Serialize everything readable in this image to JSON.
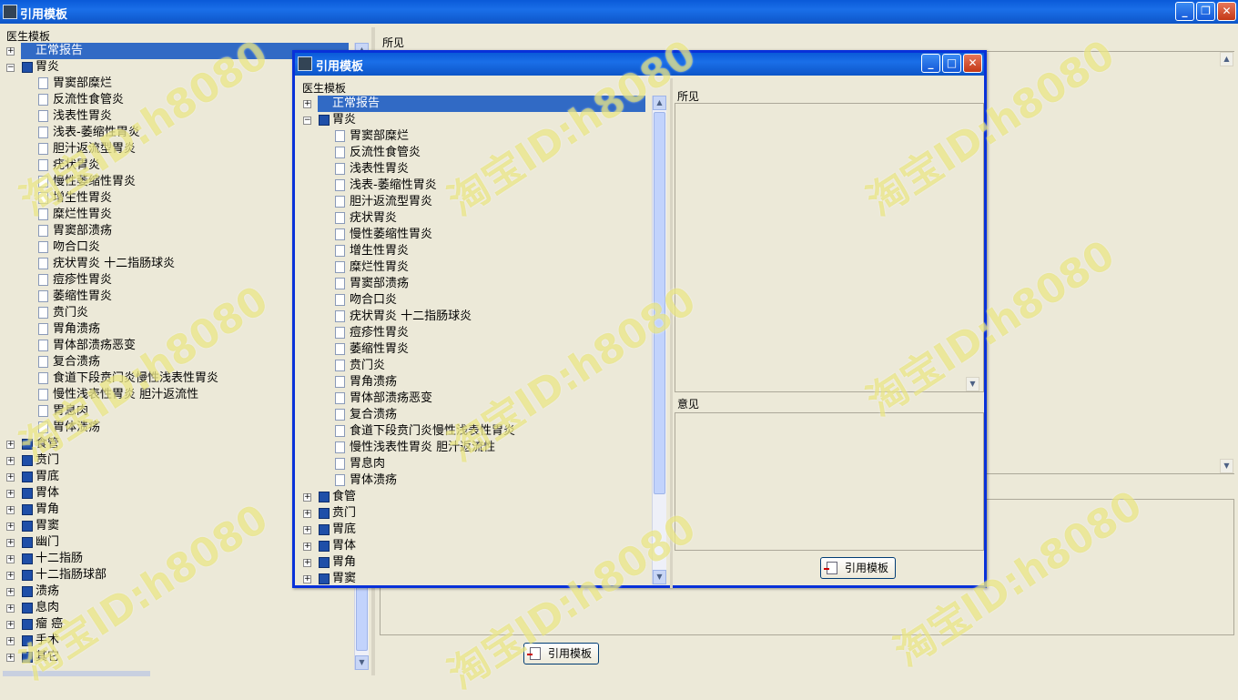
{
  "main": {
    "title": "引用模板",
    "controls": {
      "minimize": "_",
      "restore": "❐",
      "close": "✕"
    },
    "left_label": "医生模板",
    "findings_label": "所见",
    "cite_button": "引用模板",
    "tree": [
      {
        "label": "正常报告",
        "kind": "folder",
        "selected": true,
        "expander": "+"
      },
      {
        "label": "胃炎",
        "kind": "folder",
        "expander": "−"
      },
      {
        "label": "胃窦部糜烂",
        "kind": "doc"
      },
      {
        "label": "反流性食管炎",
        "kind": "doc"
      },
      {
        "label": "浅表性胃炎",
        "kind": "doc"
      },
      {
        "label": "浅表-萎缩性胃炎",
        "kind": "doc"
      },
      {
        "label": "胆汁返流型胃炎",
        "kind": "doc"
      },
      {
        "label": "疣状胃炎",
        "kind": "doc"
      },
      {
        "label": "慢性萎缩性胃炎",
        "kind": "doc"
      },
      {
        "label": "增生性胃炎",
        "kind": "doc"
      },
      {
        "label": "糜烂性胃炎",
        "kind": "doc"
      },
      {
        "label": "胃窦部溃疡",
        "kind": "doc"
      },
      {
        "label": "吻合口炎",
        "kind": "doc"
      },
      {
        "label": "疣状胃炎 十二指肠球炎",
        "kind": "doc"
      },
      {
        "label": "痘疹性胃炎",
        "kind": "doc"
      },
      {
        "label": "萎缩性胃炎",
        "kind": "doc"
      },
      {
        "label": "贲门炎",
        "kind": "doc"
      },
      {
        "label": "胃角溃疡",
        "kind": "doc"
      },
      {
        "label": "胃体部溃疡恶变",
        "kind": "doc"
      },
      {
        "label": "复合溃疡",
        "kind": "doc"
      },
      {
        "label": "食道下段贲门炎慢性浅表性胃炎",
        "kind": "doc"
      },
      {
        "label": "慢性浅表性胃炎 胆汁返流性",
        "kind": "doc"
      },
      {
        "label": "胃息肉",
        "kind": "doc"
      },
      {
        "label": "胃体溃疡",
        "kind": "doc"
      },
      {
        "label": "食管",
        "kind": "folder",
        "expander": "+"
      },
      {
        "label": "贲门",
        "kind": "folder",
        "expander": "+"
      },
      {
        "label": "胃底",
        "kind": "folder",
        "expander": "+"
      },
      {
        "label": "胃体",
        "kind": "folder",
        "expander": "+"
      },
      {
        "label": "胃角",
        "kind": "folder",
        "expander": "+"
      },
      {
        "label": "胃窦",
        "kind": "folder",
        "expander": "+"
      },
      {
        "label": "幽门",
        "kind": "folder",
        "expander": "+"
      },
      {
        "label": "十二指肠",
        "kind": "folder",
        "expander": "+"
      },
      {
        "label": "十二指肠球部",
        "kind": "folder",
        "expander": "+"
      },
      {
        "label": "溃疡",
        "kind": "folder",
        "expander": "+"
      },
      {
        "label": "息肉",
        "kind": "folder",
        "expander": "+"
      },
      {
        "label": "瘤 癌",
        "kind": "folder",
        "expander": "+"
      },
      {
        "label": "手术",
        "kind": "folder",
        "expander": "+"
      },
      {
        "label": "其它",
        "kind": "folder",
        "expander": "+"
      }
    ]
  },
  "dialog": {
    "title": "引用模板",
    "left_label": "医生模板",
    "findings_label": "所见",
    "opinion_label": "意见",
    "cite_button": "引用模板",
    "tree": [
      {
        "label": "正常报告",
        "kind": "folder",
        "selected": true,
        "expander": "+"
      },
      {
        "label": "胃炎",
        "kind": "folder",
        "expander": "−"
      },
      {
        "label": "胃窦部糜烂",
        "kind": "doc"
      },
      {
        "label": "反流性食管炎",
        "kind": "doc"
      },
      {
        "label": "浅表性胃炎",
        "kind": "doc"
      },
      {
        "label": "浅表-萎缩性胃炎",
        "kind": "doc"
      },
      {
        "label": "胆汁返流型胃炎",
        "kind": "doc"
      },
      {
        "label": "疣状胃炎",
        "kind": "doc"
      },
      {
        "label": "慢性萎缩性胃炎",
        "kind": "doc"
      },
      {
        "label": "增生性胃炎",
        "kind": "doc"
      },
      {
        "label": "糜烂性胃炎",
        "kind": "doc"
      },
      {
        "label": "胃窦部溃疡",
        "kind": "doc"
      },
      {
        "label": "吻合口炎",
        "kind": "doc"
      },
      {
        "label": "疣状胃炎 十二指肠球炎",
        "kind": "doc"
      },
      {
        "label": "痘疹性胃炎",
        "kind": "doc"
      },
      {
        "label": "萎缩性胃炎",
        "kind": "doc"
      },
      {
        "label": "贲门炎",
        "kind": "doc"
      },
      {
        "label": "胃角溃疡",
        "kind": "doc"
      },
      {
        "label": "胃体部溃疡恶变",
        "kind": "doc"
      },
      {
        "label": "复合溃疡",
        "kind": "doc"
      },
      {
        "label": "食道下段贲门炎慢性浅表性胃炎",
        "kind": "doc"
      },
      {
        "label": "慢性浅表性胃炎 胆汁返流性",
        "kind": "doc"
      },
      {
        "label": "胃息肉",
        "kind": "doc"
      },
      {
        "label": "胃体溃疡",
        "kind": "doc"
      },
      {
        "label": "食管",
        "kind": "folder",
        "expander": "+"
      },
      {
        "label": "贲门",
        "kind": "folder",
        "expander": "+"
      },
      {
        "label": "胃底",
        "kind": "folder",
        "expander": "+"
      },
      {
        "label": "胃体",
        "kind": "folder",
        "expander": "+"
      },
      {
        "label": "胃角",
        "kind": "folder",
        "expander": "+"
      },
      {
        "label": "胃窦",
        "kind": "folder",
        "expander": "+"
      }
    ]
  },
  "watermark": "淘宝ID:h8080",
  "colors": {
    "titlebar": "#0a5ad8",
    "selection": "#316ac5",
    "watermark": "#e1dc5a"
  }
}
